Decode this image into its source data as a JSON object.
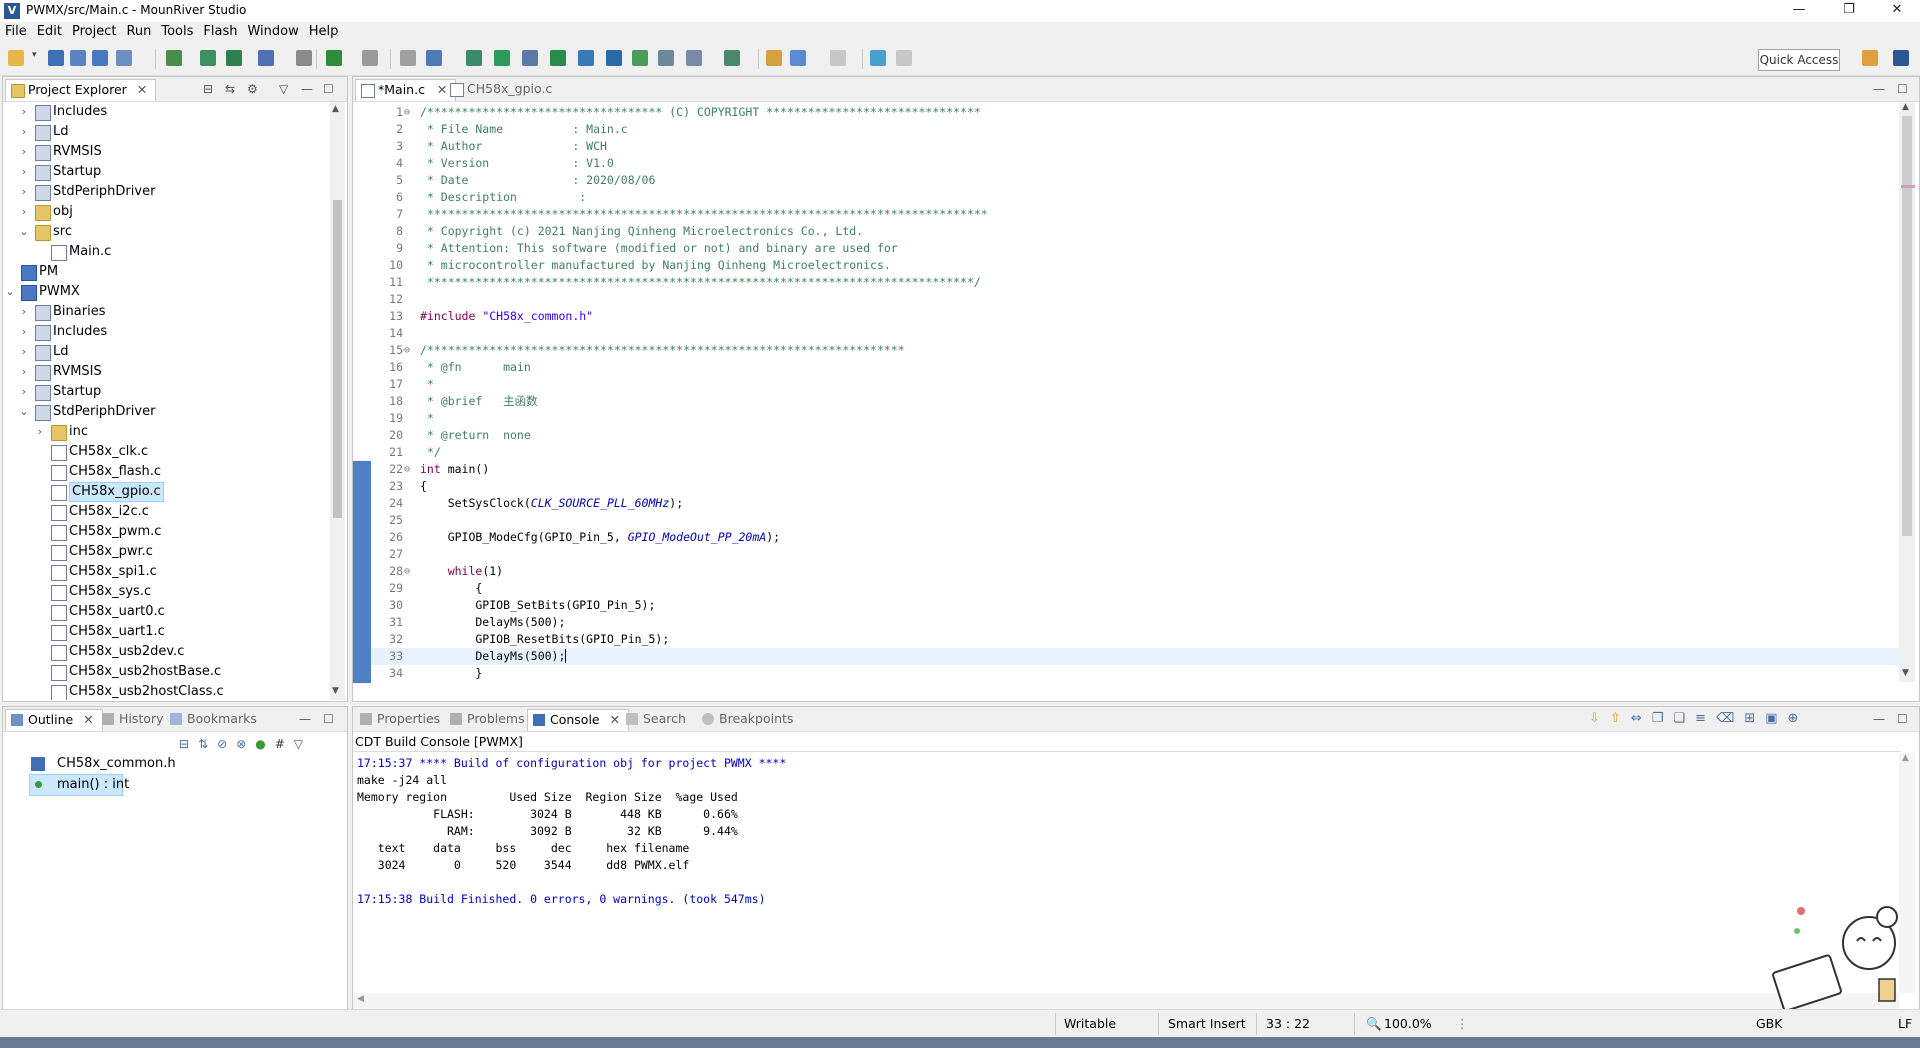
{
  "window": {
    "title": "PWMX/src/Main.c - MounRiver Studio",
    "controls": {
      "minimize": "—",
      "maximize": "❐",
      "close": "✕"
    }
  },
  "menu": [
    "File",
    "Edit",
    "Project",
    "Run",
    "Tools",
    "Flash",
    "Window",
    "Help"
  ],
  "toolbar": {
    "quick_access": "Quick Access"
  },
  "project_explorer": {
    "title": "Project Explorer",
    "items": [
      {
        "label": "Includes",
        "icon": "includes-icon",
        "level": 1,
        "expander": "collapsed"
      },
      {
        "label": "Ld",
        "icon": "folder-lib-icon",
        "level": 1,
        "expander": "collapsed"
      },
      {
        "label": "RVMSIS",
        "icon": "folder-lib-icon",
        "level": 1,
        "expander": "collapsed"
      },
      {
        "label": "Startup",
        "icon": "folder-lib-icon",
        "level": 1,
        "expander": "collapsed"
      },
      {
        "label": "StdPeriphDriver",
        "icon": "folder-lib-icon",
        "level": 1,
        "expander": "collapsed"
      },
      {
        "label": "obj",
        "icon": "folder-icon",
        "level": 1,
        "expander": "collapsed"
      },
      {
        "label": "src",
        "icon": "folder-icon",
        "level": 1,
        "expander": "expanded"
      },
      {
        "label": "Main.c",
        "icon": "c-file-icon",
        "level": 2,
        "expander": "none"
      },
      {
        "label": "PM",
        "icon": "project-icon",
        "level": 0,
        "expander": "none"
      },
      {
        "label": "PWMX",
        "icon": "project-icon",
        "level": 0,
        "expander": "expanded"
      },
      {
        "label": "Binaries",
        "icon": "binaries-icon",
        "level": 1,
        "expander": "collapsed"
      },
      {
        "label": "Includes",
        "icon": "includes-icon",
        "level": 1,
        "expander": "collapsed"
      },
      {
        "label": "Ld",
        "icon": "folder-lib-icon",
        "level": 1,
        "expander": "collapsed"
      },
      {
        "label": "RVMSIS",
        "icon": "folder-lib-icon",
        "level": 1,
        "expander": "collapsed"
      },
      {
        "label": "Startup",
        "icon": "folder-lib-icon",
        "level": 1,
        "expander": "collapsed"
      },
      {
        "label": "StdPeriphDriver",
        "icon": "folder-lib-icon",
        "level": 1,
        "expander": "expanded"
      },
      {
        "label": "inc",
        "icon": "folder-icon",
        "level": 2,
        "expander": "collapsed"
      },
      {
        "label": "CH58x_clk.c",
        "icon": "c-file-icon",
        "level": 2,
        "expander": "none"
      },
      {
        "label": "CH58x_flash.c",
        "icon": "c-file-icon",
        "level": 2,
        "expander": "none"
      },
      {
        "label": "CH58x_gpio.c",
        "icon": "c-file-icon",
        "level": 2,
        "expander": "none",
        "selected": true
      },
      {
        "label": "CH58x_i2c.c",
        "icon": "c-file-icon",
        "level": 2,
        "expander": "none"
      },
      {
        "label": "CH58x_pwm.c",
        "icon": "c-file-icon",
        "level": 2,
        "expander": "none"
      },
      {
        "label": "CH58x_pwr.c",
        "icon": "c-file-icon",
        "level": 2,
        "expander": "none"
      },
      {
        "label": "CH58x_spi1.c",
        "icon": "c-file-icon",
        "level": 2,
        "expander": "none"
      },
      {
        "label": "CH58x_sys.c",
        "icon": "c-file-icon",
        "level": 2,
        "expander": "none"
      },
      {
        "label": "CH58x_uart0.c",
        "icon": "c-file-icon",
        "level": 2,
        "expander": "none"
      },
      {
        "label": "CH58x_uart1.c",
        "icon": "c-file-icon",
        "level": 2,
        "expander": "none"
      },
      {
        "label": "CH58x_usb2dev.c",
        "icon": "c-file-icon",
        "level": 2,
        "expander": "none"
      },
      {
        "label": "CH58x_usb2hostBase.c",
        "icon": "c-file-icon",
        "level": 2,
        "expander": "none"
      },
      {
        "label": "CH58x_usb2hostClass.c",
        "icon": "c-file-icon",
        "level": 2,
        "expander": "none"
      }
    ]
  },
  "editor": {
    "tabs": [
      {
        "label": "*Main.c",
        "active": true
      },
      {
        "label": "CH58x_gpio.c",
        "active": false
      }
    ],
    "lines": [
      {
        "n": "1",
        "fold": "⊖",
        "segs": [
          {
            "t": "/********************************** (C) COPYRIGHT *******************************",
            "c": "cm"
          }
        ]
      },
      {
        "n": "2",
        "segs": [
          {
            "t": " * File Name          : Main.c",
            "c": "cm"
          }
        ]
      },
      {
        "n": "3",
        "segs": [
          {
            "t": " * Author             : WCH",
            "c": "cm"
          }
        ]
      },
      {
        "n": "4",
        "segs": [
          {
            "t": " * Version            : V1.0",
            "c": "cm"
          }
        ]
      },
      {
        "n": "5",
        "segs": [
          {
            "t": " * Date               : 2020/08/06",
            "c": "cm"
          }
        ]
      },
      {
        "n": "6",
        "segs": [
          {
            "t": " * Description         :",
            "c": "cm"
          }
        ]
      },
      {
        "n": "7",
        "segs": [
          {
            "t": " *********************************************************************************",
            "c": "cm"
          }
        ]
      },
      {
        "n": "8",
        "segs": [
          {
            "t": " * Copyright (c) 2021 Nanjing Qinheng Microelectronics Co., Ltd.",
            "c": "cm"
          }
        ]
      },
      {
        "n": "9",
        "segs": [
          {
            "t": " * Attention: This software (modified or not) and binary are used for",
            "c": "cm"
          }
        ]
      },
      {
        "n": "10",
        "segs": [
          {
            "t": " * microcontroller manufactured by Nanjing Qinheng Microelectronics.",
            "c": "cm"
          }
        ]
      },
      {
        "n": "11",
        "segs": [
          {
            "t": " *******************************************************************************/",
            "c": "cm"
          }
        ]
      },
      {
        "n": "12",
        "segs": []
      },
      {
        "n": "13",
        "segs": [
          {
            "t": "#include ",
            "c": "kw"
          },
          {
            "t": "\"CH58x_common.h\"",
            "c": "st"
          }
        ]
      },
      {
        "n": "14",
        "segs": []
      },
      {
        "n": "15",
        "fold": "⊖",
        "segs": [
          {
            "t": "/*********************************************************************",
            "c": "cm"
          }
        ]
      },
      {
        "n": "16",
        "segs": [
          {
            "t": " * @fn      main",
            "c": "cm"
          }
        ]
      },
      {
        "n": "17",
        "segs": [
          {
            "t": " *",
            "c": "cm"
          }
        ]
      },
      {
        "n": "18",
        "segs": [
          {
            "t": " * @brief   主函数",
            "c": "cm"
          }
        ]
      },
      {
        "n": "19",
        "segs": [
          {
            "t": " *",
            "c": "cm"
          }
        ]
      },
      {
        "n": "20",
        "segs": [
          {
            "t": " * @return  none",
            "c": "cm"
          }
        ]
      },
      {
        "n": "21",
        "segs": [
          {
            "t": " */",
            "c": "cm"
          }
        ]
      },
      {
        "n": "22",
        "fold": "⊖",
        "segs": [
          {
            "t": "int",
            "c": "kw"
          },
          {
            "t": " main()",
            "c": "pl"
          }
        ]
      },
      {
        "n": "23",
        "segs": [
          {
            "t": "{",
            "c": "pl"
          }
        ]
      },
      {
        "n": "24",
        "segs": [
          {
            "t": "    SetSysClock(",
            "c": "pl"
          },
          {
            "t": "CLK_SOURCE_PLL_60MHz",
            "c": "it"
          },
          {
            "t": ");",
            "c": "pl"
          }
        ]
      },
      {
        "n": "25",
        "segs": []
      },
      {
        "n": "26",
        "segs": [
          {
            "t": "    GPIOB_ModeCfg(GPIO_Pin_5, ",
            "c": "pl"
          },
          {
            "t": "GPIO_ModeOut_PP_20mA",
            "c": "it"
          },
          {
            "t": ");",
            "c": "pl"
          }
        ]
      },
      {
        "n": "27",
        "segs": []
      },
      {
        "n": "28",
        "fold": "⊖",
        "segs": [
          {
            "t": "    ",
            "c": "pl"
          },
          {
            "t": "while",
            "c": "kw"
          },
          {
            "t": "(1)",
            "c": "pl"
          }
        ]
      },
      {
        "n": "29",
        "segs": [
          {
            "t": "        {",
            "c": "pl"
          }
        ]
      },
      {
        "n": "30",
        "segs": [
          {
            "t": "        GPIOB_SetBits(GPIO_Pin_5);",
            "c": "pl"
          }
        ]
      },
      {
        "n": "31",
        "segs": [
          {
            "t": "        DelayMs(500);",
            "c": "pl"
          }
        ]
      },
      {
        "n": "32",
        "segs": [
          {
            "t": "        GPIOB_ResetBits(GPIO_Pin_5);",
            "c": "pl"
          }
        ]
      },
      {
        "n": "33",
        "segs": [
          {
            "t": "        DelayMs(500);",
            "c": "pl"
          }
        ],
        "current": true
      },
      {
        "n": "34",
        "segs": [
          {
            "t": "        }",
            "c": "pl"
          }
        ]
      }
    ]
  },
  "outline": {
    "tabs": [
      "Outline",
      "History",
      "Bookmarks"
    ],
    "items": [
      {
        "label": "CH58x_common.h",
        "icon": "include-file-icon"
      },
      {
        "label": "main() : int",
        "icon": "function-icon",
        "selected": true
      }
    ]
  },
  "bottom_panel": {
    "tabs": [
      "Properties",
      "Problems",
      "Console",
      "Search",
      "Breakpoints"
    ],
    "active_tab": "Console",
    "console_title": "CDT Build Console [PWMX]",
    "lines": [
      {
        "t": "17:15:37 **** Build of configuration obj for project PWMX ****",
        "c": "blue"
      },
      {
        "t": "make -j24 all",
        "c": ""
      },
      {
        "t": "Memory region         Used Size  Region Size  %age Used",
        "c": ""
      },
      {
        "t": "           FLASH:        3024 B       448 KB      0.66%",
        "c": ""
      },
      {
        "t": "             RAM:        3092 B        32 KB      9.44%",
        "c": ""
      },
      {
        "t": "   text    data     bss     dec     hex filename",
        "c": ""
      },
      {
        "t": "   3024       0     520    3544     dd8 PWMX.elf",
        "c": ""
      },
      {
        "t": "",
        "c": ""
      },
      {
        "t": "17:15:38 Build Finished. 0 errors, 0 warnings. (took 547ms)",
        "c": "blue"
      }
    ]
  },
  "status": {
    "writable": "Writable",
    "insert_mode": "Smart Insert",
    "position": "33 : 22",
    "zoom": "100.0%",
    "encoding": "GBK",
    "line_ending": "LF"
  },
  "colors": {
    "comment": "#3f7f5f",
    "keyword": "#7f0055",
    "string": "#2a00ff",
    "macro": "#0000c0",
    "console_info": "#0000c8",
    "selection": "#cce8ff"
  }
}
